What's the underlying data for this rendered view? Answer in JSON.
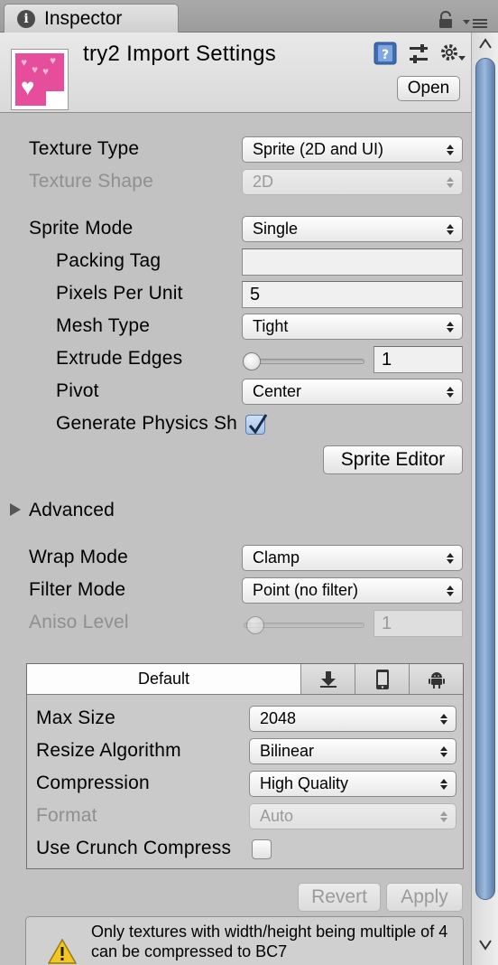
{
  "tab": {
    "title": "Inspector"
  },
  "header": {
    "title": "try2 Import Settings",
    "open_label": "Open"
  },
  "texture": {
    "type_label": "Texture Type",
    "type_value": "Sprite (2D and UI)",
    "shape_label": "Texture Shape",
    "shape_value": "2D",
    "sprite_mode_label": "Sprite Mode",
    "sprite_mode_value": "Single",
    "packing_tag_label": "Packing Tag",
    "packing_tag_value": "",
    "ppu_label": "Pixels Per Unit",
    "ppu_value": "5",
    "mesh_type_label": "Mesh Type",
    "mesh_type_value": "Tight",
    "extrude_label": "Extrude Edges",
    "extrude_value": "1",
    "pivot_label": "Pivot",
    "pivot_value": "Center",
    "physics_label": "Generate Physics Sh",
    "physics_checked": true,
    "sprite_editor_label": "Sprite Editor",
    "advanced_label": "Advanced",
    "wrap_label": "Wrap Mode",
    "wrap_value": "Clamp",
    "filter_label": "Filter Mode",
    "filter_value": "Point (no filter)",
    "aniso_label": "Aniso Level",
    "aniso_value": "1"
  },
  "platform": {
    "default_tab": "Default",
    "icons": [
      "download-icon",
      "phone-icon",
      "android-icon"
    ],
    "max_size_label": "Max Size",
    "max_size_value": "2048",
    "resize_label": "Resize Algorithm",
    "resize_value": "Bilinear",
    "compression_label": "Compression",
    "compression_value": "High Quality",
    "format_label": "Format",
    "format_value": "Auto",
    "crunch_label": "Use Crunch Compress",
    "crunch_checked": false
  },
  "actions": {
    "revert_label": "Revert",
    "apply_label": "Apply"
  },
  "warning": {
    "text": "Only textures with width/height being multiple of 4 can be compressed to BC7"
  },
  "colors": {
    "accent": "#5c7dab",
    "panel_bg": "#c2c2c2",
    "pink": "#e64d9a"
  }
}
